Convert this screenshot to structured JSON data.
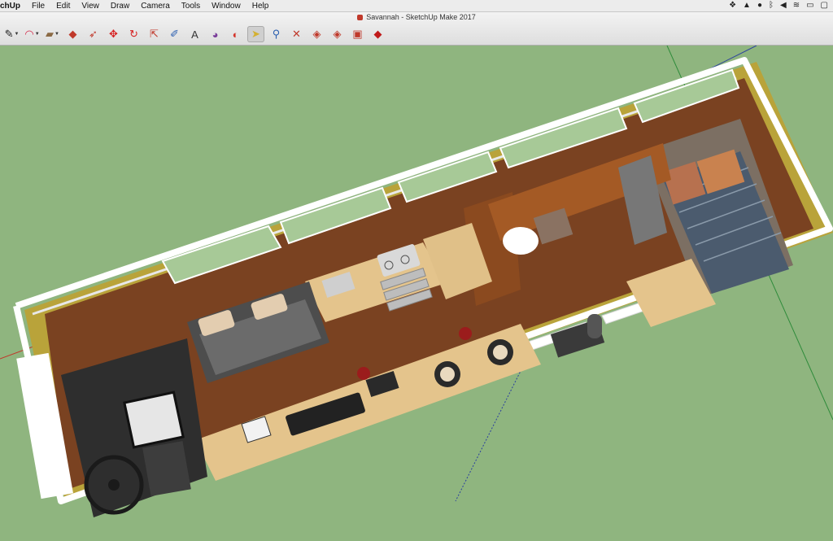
{
  "menubar": {
    "app": "chUp",
    "items": [
      "File",
      "Edit",
      "View",
      "Draw",
      "Camera",
      "Tools",
      "Window",
      "Help"
    ],
    "tray_icons": [
      "dropbox-icon",
      "drive-icon",
      "creative-cloud-icon",
      "bluetooth-icon",
      "volume-icon",
      "wifi-icon",
      "battery-icon",
      "display-icon"
    ]
  },
  "window": {
    "title": "Savannah - SketchUp Make 2017"
  },
  "toolbar": {
    "tools": [
      {
        "name": "pencil-tool-icon",
        "glyph": "✎",
        "color": "#222222",
        "caret": true
      },
      {
        "name": "arc-tool-icon",
        "glyph": "◠",
        "color": "#d42a4a",
        "caret": true
      },
      {
        "name": "rectangle-tool-icon",
        "glyph": "▰",
        "color": "#8b6a45",
        "caret": true
      },
      {
        "name": "push-pull-icon",
        "glyph": "◆",
        "color": "#c0392b",
        "caret": false
      },
      {
        "name": "follow-me-icon",
        "glyph": "➶",
        "color": "#c0392b",
        "caret": false
      },
      {
        "name": "move-tool-icon",
        "glyph": "✥",
        "color": "#d61f1f",
        "caret": false
      },
      {
        "name": "rotate-tool-icon",
        "glyph": "↻",
        "color": "#d61f1f",
        "caret": false
      },
      {
        "name": "scale-tool-icon",
        "glyph": "⇱",
        "color": "#c0392b",
        "caret": false
      },
      {
        "name": "tape-measure-icon",
        "glyph": "✐",
        "color": "#2b5fb0",
        "caret": false
      },
      {
        "name": "text-tool-icon",
        "glyph": "A",
        "color": "#333333",
        "caret": false
      },
      {
        "name": "paint-bucket-icon",
        "glyph": "◕",
        "color": "#7a3d9a",
        "caret": false
      },
      {
        "name": "section-plane-icon",
        "glyph": "◐",
        "color": "#d4352b",
        "caret": false
      },
      {
        "name": "select-tool-icon",
        "glyph": "➤",
        "color": "#d4b030",
        "caret": false,
        "active": true
      },
      {
        "name": "zoom-tool-icon",
        "glyph": "⚲",
        "color": "#2b5fb0",
        "caret": false
      },
      {
        "name": "zoom-extents-icon",
        "glyph": "✕",
        "color": "#c0392b",
        "caret": false
      },
      {
        "name": "warehouse-icon",
        "glyph": "◈",
        "color": "#c0392b",
        "caret": false
      },
      {
        "name": "share-model-icon",
        "glyph": "◈",
        "color": "#c0392b",
        "caret": false
      },
      {
        "name": "extension-warehouse-icon",
        "glyph": "▣",
        "color": "#c0392b",
        "caret": false
      },
      {
        "name": "ruby-icon",
        "glyph": "◆",
        "color": "#c01a1a",
        "caret": false
      }
    ]
  },
  "scene": {
    "ground_color": "#8fb57f",
    "floor_color": "#7a4221",
    "counter_color": "#e4c48c",
    "wall_color": "#ffffff"
  }
}
